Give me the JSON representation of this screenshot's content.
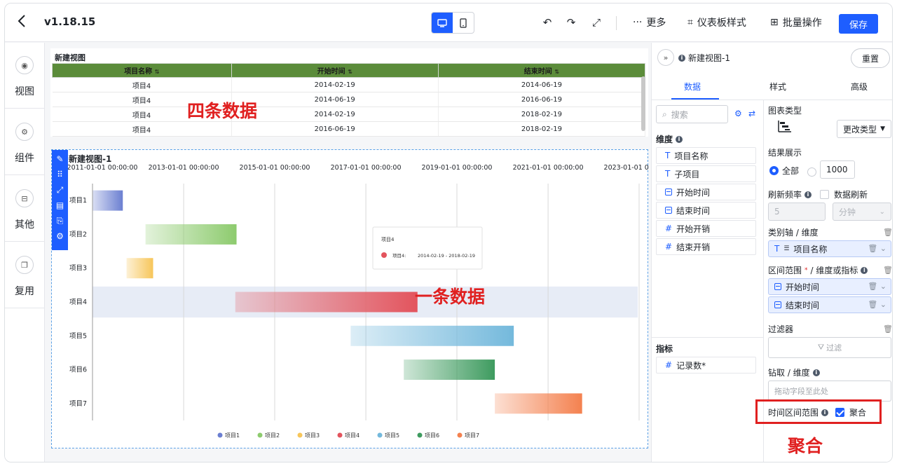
{
  "topbar": {
    "version": "v1.18.15",
    "more_label": "更多",
    "dashboard_style_label": "仪表板样式",
    "batch_label": "批量操作",
    "save_label": "保存"
  },
  "leftbar": {
    "items": [
      {
        "label": "视图"
      },
      {
        "label": "组件"
      },
      {
        "label": "其他"
      },
      {
        "label": "复用"
      }
    ]
  },
  "table_view": {
    "title": "新建视图",
    "columns": [
      "项目名称",
      "开始时间",
      "结束时间"
    ],
    "rows": [
      [
        "项目4",
        "2014-02-19",
        "2014-06-19"
      ],
      [
        "项目4",
        "2014-06-19",
        "2016-06-19"
      ],
      [
        "项目4",
        "2014-02-19",
        "2018-02-19"
      ],
      [
        "项目4",
        "2016-06-19",
        "2018-02-19"
      ]
    ]
  },
  "annotations": {
    "four_rows": "四条数据",
    "one_row": "一条数据",
    "aggregate": "聚合"
  },
  "gantt": {
    "title": "新建视图-1",
    "tooltip_title": "项目4",
    "tooltip_series": "项目4:",
    "tooltip_range": "2014-02-19 - 2018-02-19"
  },
  "chart_data": {
    "type": "bar",
    "subtype": "gantt",
    "title": "新建视图-1",
    "x_axis_type": "time",
    "x_ticks": [
      "2011-01-01 00:00:00",
      "2013-01-01 00:00:00",
      "2015-01-01 00:00:00",
      "2017-01-01 00:00:00",
      "2019-01-01 00:00:00",
      "2021-01-01 00:00:00",
      "2023-01-01 00:00:00"
    ],
    "x_range": [
      "2011-01-01",
      "2023-01-01"
    ],
    "categories": [
      "项目1",
      "项目2",
      "项目3",
      "项目4",
      "项目5",
      "项目6",
      "项目7"
    ],
    "series": [
      {
        "name": "项目1",
        "start": "2011-01-01",
        "end": "2011-09-01",
        "color": "#6b7fd1"
      },
      {
        "name": "项目2",
        "start": "2012-03-01",
        "end": "2014-03-01",
        "color": "#8dcb6e"
      },
      {
        "name": "项目3",
        "start": "2011-10-01",
        "end": "2012-05-01",
        "color": "#f7c65a"
      },
      {
        "name": "项目4",
        "start": "2014-02-19",
        "end": "2018-02-19",
        "color": "#e3545d"
      },
      {
        "name": "项目5",
        "start": "2016-09-01",
        "end": "2020-04-01",
        "color": "#74b9dc"
      },
      {
        "name": "项目6",
        "start": "2017-11-01",
        "end": "2019-11-01",
        "color": "#3e9b5f"
      },
      {
        "name": "项目7",
        "start": "2019-11-01",
        "end": "2021-10-01",
        "color": "#f4814f"
      }
    ],
    "legend": [
      "项目1",
      "项目2",
      "项目3",
      "项目4",
      "项目5",
      "项目6",
      "项目7"
    ],
    "legend_position": "bottom",
    "highlighted_category": "项目4",
    "grid": true
  },
  "rpanel": {
    "title": "新建视图-1",
    "reset_label": "重置",
    "tabs": [
      "数据",
      "样式",
      "高级"
    ],
    "search_placeholder": "搜索",
    "dimension_label": "维度",
    "dimensions": [
      {
        "tag": "T",
        "label": "项目名称"
      },
      {
        "tag": "T",
        "label": "子项目"
      },
      {
        "tag": "date",
        "label": "开始时间"
      },
      {
        "tag": "date",
        "label": "结束时间"
      },
      {
        "tag": "#",
        "label": "开始开销"
      },
      {
        "tag": "#",
        "label": "结束开销"
      }
    ],
    "metric_label": "指标",
    "metrics": [
      {
        "tag": "#",
        "label": "记录数*"
      }
    ],
    "chart_type_label": "图表类型",
    "change_type_label": "更改类型",
    "result_label": "结果展示",
    "result_all": "全部",
    "result_count": "1000",
    "refresh_label": "刷新频率",
    "data_refresh_label": "数据刷新",
    "refresh_value": "5",
    "refresh_unit": "分钟",
    "category_axis_label": "类别轴 / 维度",
    "category_field": "项目名称",
    "range_label": "区间范围",
    "range_label_suffix": "/ 维度或指标",
    "range_fields": [
      "开始时间",
      "结束时间"
    ],
    "filter_label": "过滤器",
    "filter_placeholder": "过滤",
    "drill_label": "钻取 / 维度",
    "drill_placeholder": "拖动字段至此处",
    "time_range_label": "时间区间范围",
    "aggregate_label": "聚合"
  }
}
